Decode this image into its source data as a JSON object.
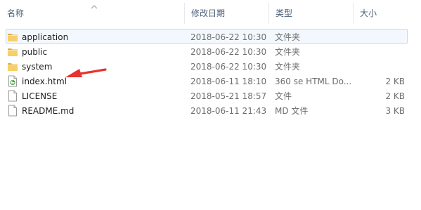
{
  "columns": {
    "name": "名称",
    "date": "修改日期",
    "type": "类型",
    "size": "大小"
  },
  "files": [
    {
      "name": "application",
      "date": "2018-06-22 10:30",
      "type": "文件夹",
      "size": "",
      "icon": "folder-icon",
      "selected": true
    },
    {
      "name": "public",
      "date": "2018-06-22 10:30",
      "type": "文件夹",
      "size": "",
      "icon": "folder-icon"
    },
    {
      "name": "system",
      "date": "2018-06-22 10:30",
      "type": "文件夹",
      "size": "",
      "icon": "folder-icon"
    },
    {
      "name": "index.html",
      "date": "2018-06-11 18:10",
      "type": "360 se HTML Do...",
      "size": "2 KB",
      "icon": "html-file-icon"
    },
    {
      "name": "LICENSE",
      "date": "2018-05-21 18:57",
      "type": "文件",
      "size": "2 KB",
      "icon": "file-icon"
    },
    {
      "name": "README.md",
      "date": "2018-06-11 21:43",
      "type": "MD 文件",
      "size": "3 KB",
      "icon": "file-icon"
    }
  ],
  "colors": {
    "selection_bg": "#f3f8fe",
    "selection_border": "#bedaf5",
    "annotation_arrow": "#e8322d",
    "folder": "#e8b84a"
  }
}
